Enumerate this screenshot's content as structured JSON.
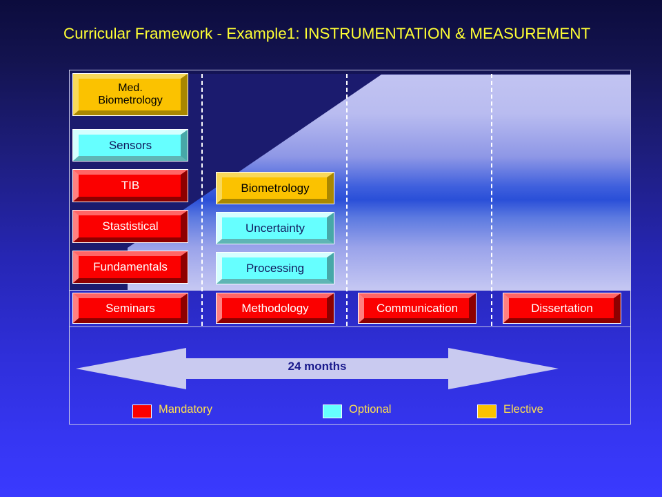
{
  "title": "Curricular Framework - Example1: INSTRUMENTATION & MEASUREMENT",
  "colors": {
    "mandatory": "#fb0000",
    "optional": "#66ffff",
    "elective": "#fbc200",
    "title_text": "#ffff33",
    "legend_text": "#ffe14d",
    "ramp_light": "#c9caf0",
    "background_dark": "#1b1b6e"
  },
  "columns": [
    {
      "id": "column-1",
      "boxes": [
        {
          "label": "Med.\nBiometrology",
          "category": "elective"
        },
        {
          "label": "Sensors",
          "category": "optional"
        },
        {
          "label": "TIB",
          "category": "mandatory"
        },
        {
          "label": "Stastistical",
          "category": "mandatory"
        },
        {
          "label": "Fundamentals",
          "category": "mandatory"
        }
      ],
      "bottom_box": {
        "label": "Seminars",
        "category": "mandatory"
      }
    },
    {
      "id": "column-2",
      "boxes": [
        {
          "label": "Biometrology",
          "category": "elective"
        },
        {
          "label": "Uncertainty",
          "category": "optional"
        },
        {
          "label": "Processing",
          "category": "optional"
        }
      ],
      "bottom_box": {
        "label": "Methodology",
        "category": "mandatory"
      }
    },
    {
      "id": "column-3",
      "boxes": [],
      "bottom_box": {
        "label": "Communication",
        "category": "mandatory"
      }
    },
    {
      "id": "column-4",
      "boxes": [],
      "bottom_box": {
        "label": "Dissertation",
        "category": "mandatory"
      }
    }
  ],
  "timeline": {
    "label": "24 months",
    "direction": "double-headed"
  },
  "legend": {
    "items": [
      {
        "label": "Mandatory",
        "color": "#fb0000"
      },
      {
        "label": "Optional",
        "color": "#66ffff"
      },
      {
        "label": "Elective",
        "color": "#fbc200"
      }
    ]
  }
}
